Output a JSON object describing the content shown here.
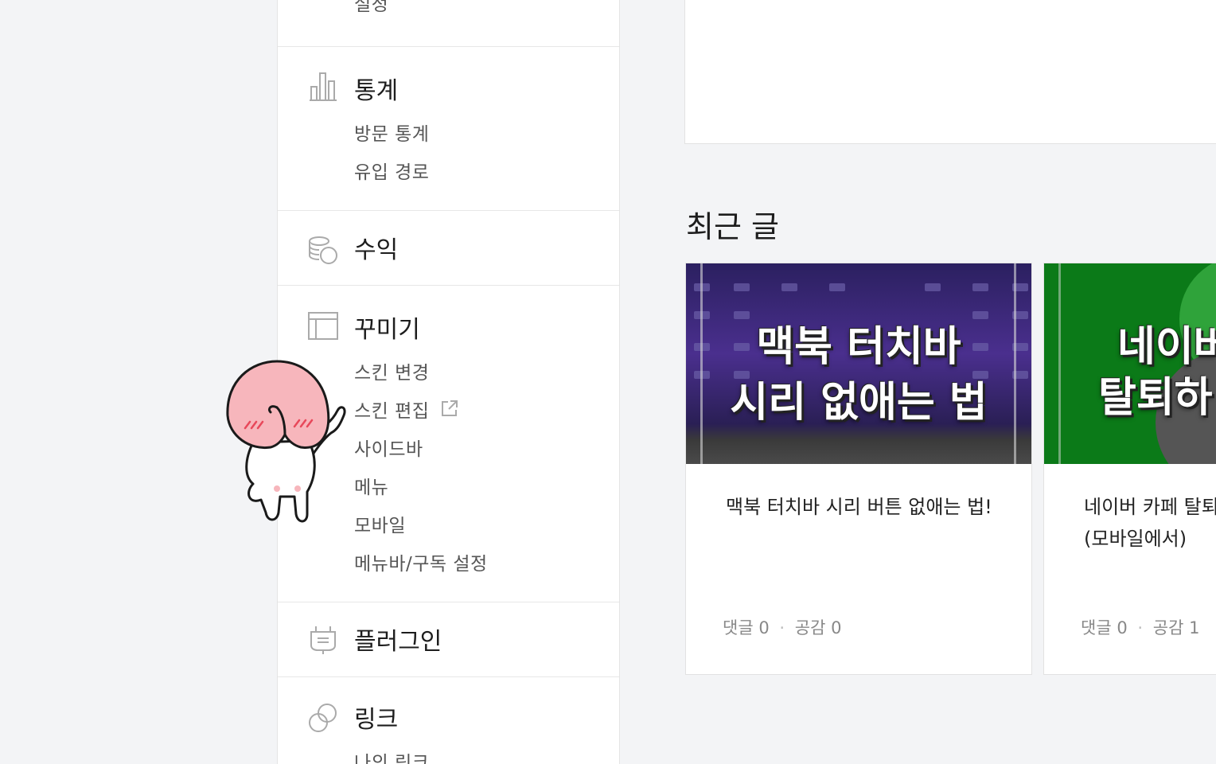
{
  "sidebar": {
    "settings_cut": "설정",
    "stats": {
      "title": "통계",
      "items": [
        "방문 통계",
        "유입 경로"
      ],
      "icon": "bar-chart-icon"
    },
    "revenue": {
      "title": "수익",
      "icon": "coins-icon"
    },
    "decorate": {
      "title": "꾸미기",
      "items": [
        "스킨 변경",
        "스킨 편집",
        "사이드바",
        "메뉴",
        "모바일",
        "메뉴바/구독 설정"
      ],
      "icon": "layout-icon"
    },
    "plugin": {
      "title": "플러그인",
      "icon": "plug-icon"
    },
    "link": {
      "title": "링크",
      "items_cut": "나의 링크",
      "icon": "link-icon"
    }
  },
  "main": {
    "recent_title": "최근 글",
    "posts": [
      {
        "thumb_line1": "맥북 터치바",
        "thumb_line2": "시리 없애는 법",
        "title": "맥북 터치바 시리 버튼 없애는 법!",
        "comments": "댓글 0",
        "likes": "공감 0",
        "sep": "·"
      },
      {
        "thumb_line1": "네이버",
        "thumb_line2": "탈퇴하",
        "title": "네이버 카페 탈퇴 (모바일에서)",
        "comments": "댓글 0",
        "likes": "공감 1",
        "sep": "·"
      }
    ]
  },
  "colors": {
    "accent_green": "#0b8a1e",
    "thumb_purple": "#3c2a7a",
    "peach": "#f7b6bc"
  }
}
